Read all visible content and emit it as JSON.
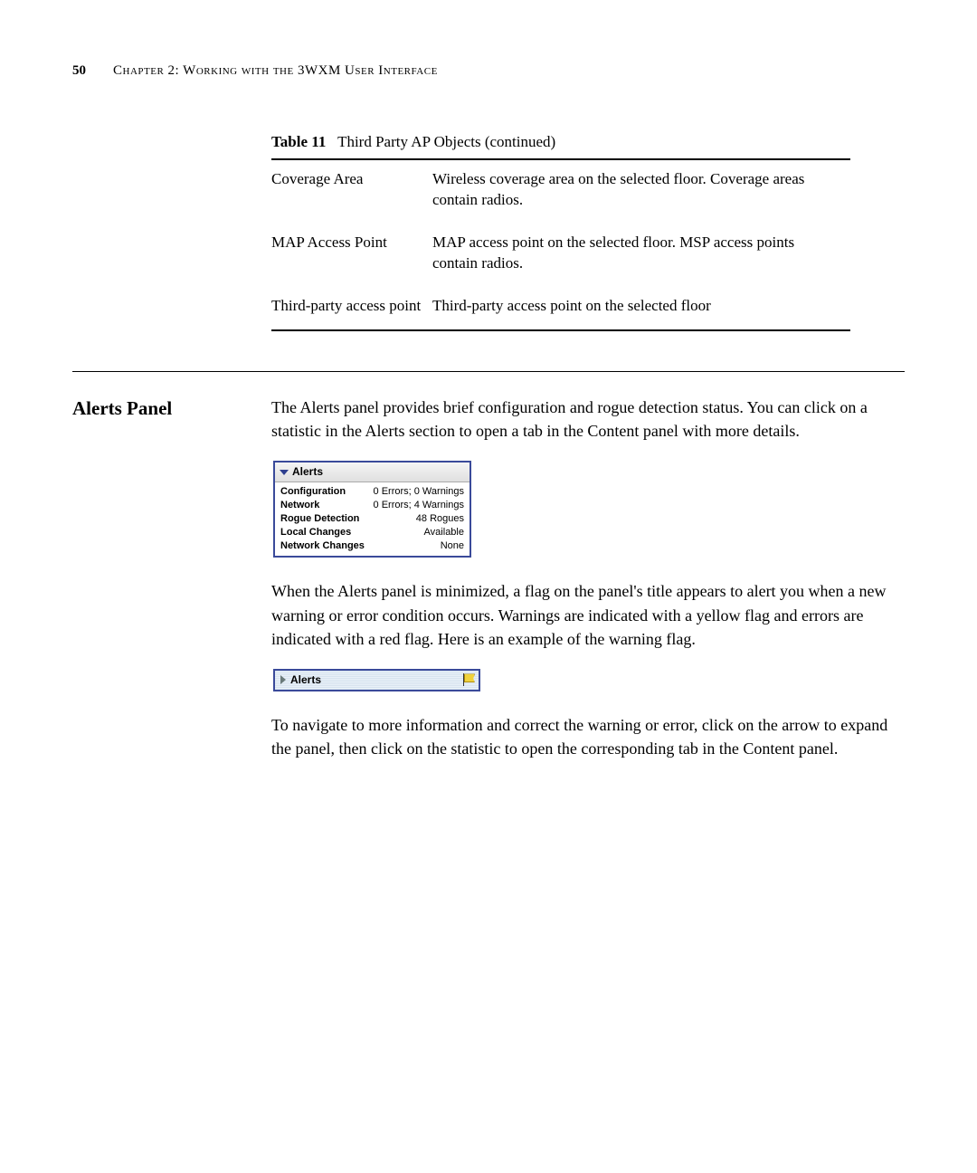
{
  "header": {
    "page_number": "50",
    "chapter": "Chapter 2: Working with the 3WXM User Interface"
  },
  "table": {
    "caption_bold": "Table 11",
    "caption_rest": "Third Party AP Objects (continued)",
    "rows": [
      {
        "name": "Coverage Area",
        "desc": "Wireless coverage area on the selected floor. Coverage areas contain radios."
      },
      {
        "name": "MAP Access Point",
        "desc": "MAP access point on the selected floor. MSP access points contain radios."
      },
      {
        "name": "Third-party access point",
        "desc": "Third-party access point on the selected floor"
      }
    ]
  },
  "section": {
    "heading": "Alerts Panel",
    "para1": "The Alerts panel provides brief configuration and rogue detection status. You can click on a statistic in the Alerts section to open a tab in the Content panel with more details.",
    "para2": "When the Alerts panel is minimized, a flag on the panel's title appears to alert you when a new warning or error condition occurs. Warnings are indicated with a yellow flag and errors are indicated with a red flag. Here is an example of the warning flag.",
    "para3": "To navigate to more information and correct the warning or error, click on the arrow to expand the panel, then click on the statistic to open the corresponding tab in the Content panel."
  },
  "alerts_expanded": {
    "title": "Alerts",
    "rows": [
      {
        "label": "Configuration",
        "value": "0 Errors; 0 Warnings"
      },
      {
        "label": "Network",
        "value": "0 Errors; 4 Warnings"
      },
      {
        "label": "Rogue Detection",
        "value": "48 Rogues"
      },
      {
        "label": "Local Changes",
        "value": "Available"
      },
      {
        "label": "Network Changes",
        "value": "None"
      }
    ]
  },
  "alerts_min": {
    "title": "Alerts"
  }
}
